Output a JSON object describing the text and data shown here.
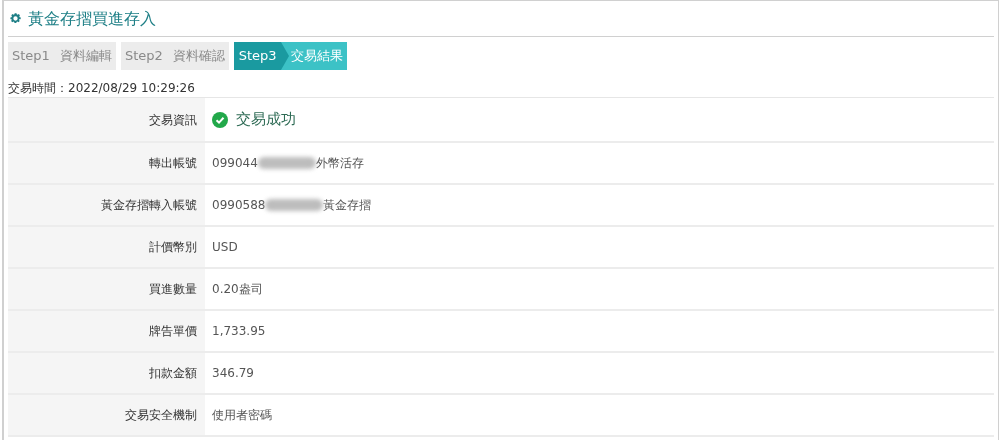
{
  "title": "黃金存摺買進存入",
  "steps": [
    {
      "step": "Step1",
      "label": "資料編輯",
      "selected": false
    },
    {
      "step": "Step2",
      "label": "資料確認",
      "selected": false
    },
    {
      "step": "Step3",
      "label": "交易結果",
      "selected": true
    }
  ],
  "transaction_time": "交易時間：2022/08/29 10:29:26",
  "rows": [
    {
      "label": "交易資訊",
      "kind": "status",
      "value": "交易成功"
    },
    {
      "label": "轉出帳號",
      "kind": "redacted",
      "value": "099044",
      "suffix": "外幣活存"
    },
    {
      "label": "黃金存摺轉入帳號",
      "kind": "redacted",
      "value": "0990588",
      "suffix": "黃金存摺"
    },
    {
      "label": "計價幣別",
      "kind": "text",
      "value": "USD"
    },
    {
      "label": "買進數量",
      "kind": "text",
      "value": "0.20盎司"
    },
    {
      "label": "牌告單價",
      "kind": "text",
      "value": "1,733.95"
    },
    {
      "label": "扣款金額",
      "kind": "text",
      "value": "346.79"
    },
    {
      "label": "交易安全機制",
      "kind": "text",
      "value": "使用者密碼"
    }
  ]
}
